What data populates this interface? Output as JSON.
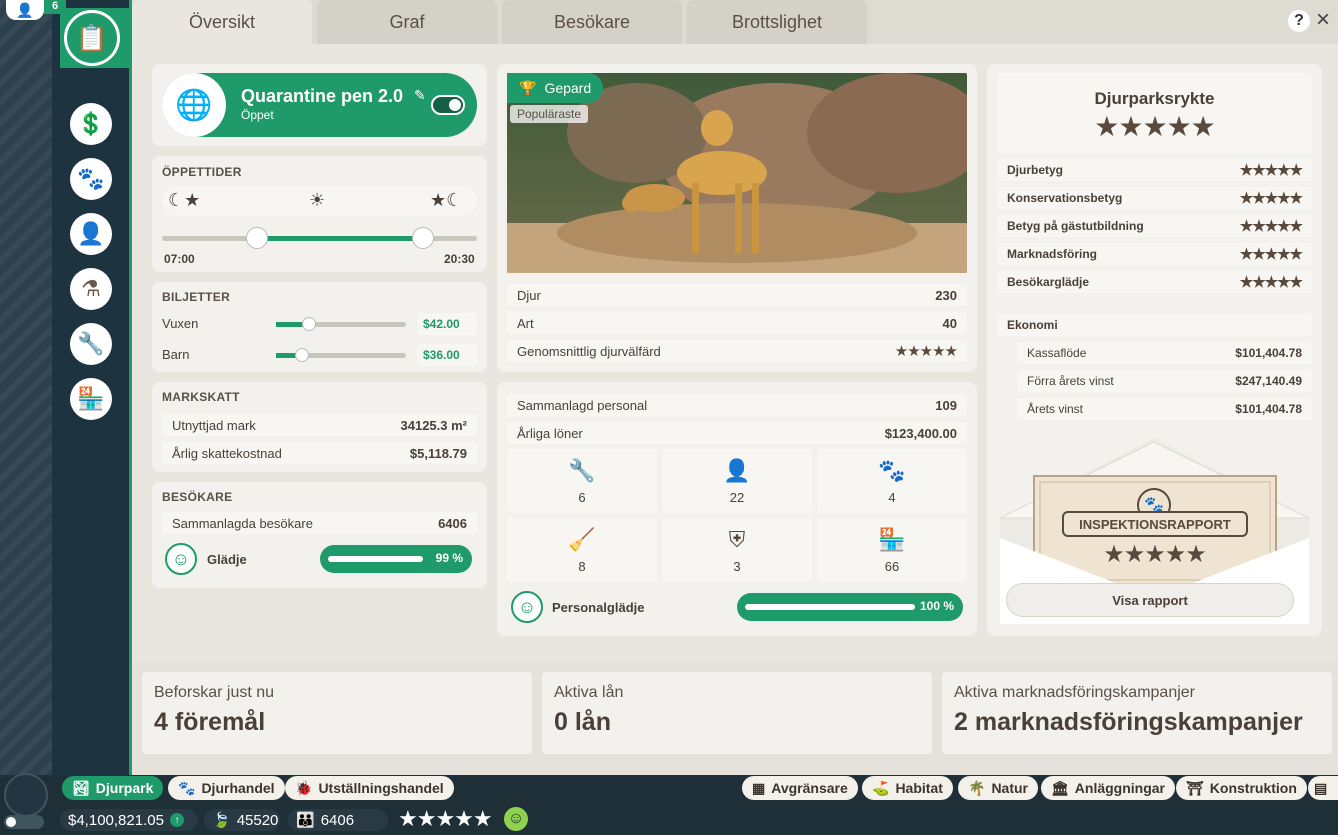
{
  "top_left": {
    "count": "6"
  },
  "tabs": [
    "Översikt",
    "Graf",
    "Besökare",
    "Brottslighet"
  ],
  "help_label": "?",
  "close_label": "×",
  "habitat": {
    "name": "Quarantine pen 2.0",
    "status": "Öppet"
  },
  "opening_hours": {
    "title": "ÖPPETTIDER",
    "open": "07:00",
    "close": "20:30",
    "start_fraction": 0.3,
    "end_fraction": 0.83
  },
  "tickets": {
    "title": "BILJETTER",
    "items": [
      {
        "label": "Vuxen",
        "price": "$42.00",
        "fraction": 0.25
      },
      {
        "label": "Barn",
        "price": "$36.00",
        "fraction": 0.2
      }
    ]
  },
  "land_tax": {
    "title": "MARKSKATT",
    "rows": [
      {
        "label": "Utnyttjad mark",
        "value": "34125.3 m²"
      },
      {
        "label": "Årlig skattekostnad",
        "value": "$5,118.79"
      }
    ]
  },
  "visitors": {
    "title": "BESÖKARE",
    "total_label": "Sammanlagda besökare",
    "total_value": "6406",
    "happiness_label": "Glädje",
    "happiness_value": "99 %",
    "happiness_fraction": 0.99
  },
  "featured": {
    "animal": "Gepard",
    "badge": "Populäraste"
  },
  "animal_stats": [
    {
      "label": "Djur",
      "value": "230"
    },
    {
      "label": "Art",
      "value": "40"
    },
    {
      "label": "Genomsnittlig djurvälfärd",
      "stars": 5
    }
  ],
  "staff": {
    "total_label": "Sammanlagd personal",
    "total_value": "109",
    "wages_label": "Årliga löner",
    "wages_value": "$123,400.00",
    "cells": [
      {
        "icon": "wrench-icon",
        "glyph": "🔧",
        "count": "6"
      },
      {
        "icon": "zookeeper-icon",
        "glyph": "👤",
        "count": "22"
      },
      {
        "icon": "vet-icon",
        "glyph": "🐾",
        "count": "4"
      },
      {
        "icon": "broom-icon",
        "glyph": "🧹",
        "count": "8"
      },
      {
        "icon": "security-badge-icon",
        "glyph": "⛨",
        "count": "3"
      },
      {
        "icon": "shop-icon",
        "glyph": "🏪",
        "count": "66"
      }
    ],
    "happiness_label": "Personalglädje",
    "happiness_value": "100 %",
    "happiness_fraction": 1.0
  },
  "reputation": {
    "title": "Djurparksrykte",
    "stars": 5,
    "ratings": [
      {
        "label": "Djurbetyg",
        "stars": 5
      },
      {
        "label": "Konservationsbetyg",
        "stars": 5
      },
      {
        "label": "Betyg på gästutbildning",
        "stars": 5
      },
      {
        "label": "Marknadsföring",
        "stars": 5
      },
      {
        "label": "Besökarglädje",
        "stars": 5
      }
    ]
  },
  "economy": {
    "title": "Ekonomi",
    "rows": [
      {
        "label": "Kassaflöde",
        "value": "$101,404.78"
      },
      {
        "label": "Förra årets vinst",
        "value": "$247,140.49"
      },
      {
        "label": "Årets vinst",
        "value": "$101,404.78"
      }
    ]
  },
  "inspection": {
    "title": "INSPEKTIONSRAPPORT",
    "stars": 5,
    "button": "Visa rapport"
  },
  "bottom_panels": [
    {
      "label": "Beforskar just nu",
      "value": "4 föremål"
    },
    {
      "label": "Aktiva lån",
      "value": "0 lån"
    },
    {
      "label": "Aktiva marknadsföringskampanjer",
      "value": "2 marknadsföringskampanjer"
    }
  ],
  "bottom_left_tabs": [
    "Djurpark",
    "Djurhandel",
    "Utställningshandel"
  ],
  "bottom_right_tabs": [
    "Avgränsare",
    "Habitat",
    "Natur",
    "Anläggningar",
    "Konstruktion"
  ],
  "status": {
    "money": "$4,100,821.05",
    "conservation": "45520",
    "guests": "6406",
    "stars": 5
  },
  "colors": {
    "accent": "#1f9a6a",
    "text": "#4a4038",
    "panel": "#f2f1ed"
  }
}
